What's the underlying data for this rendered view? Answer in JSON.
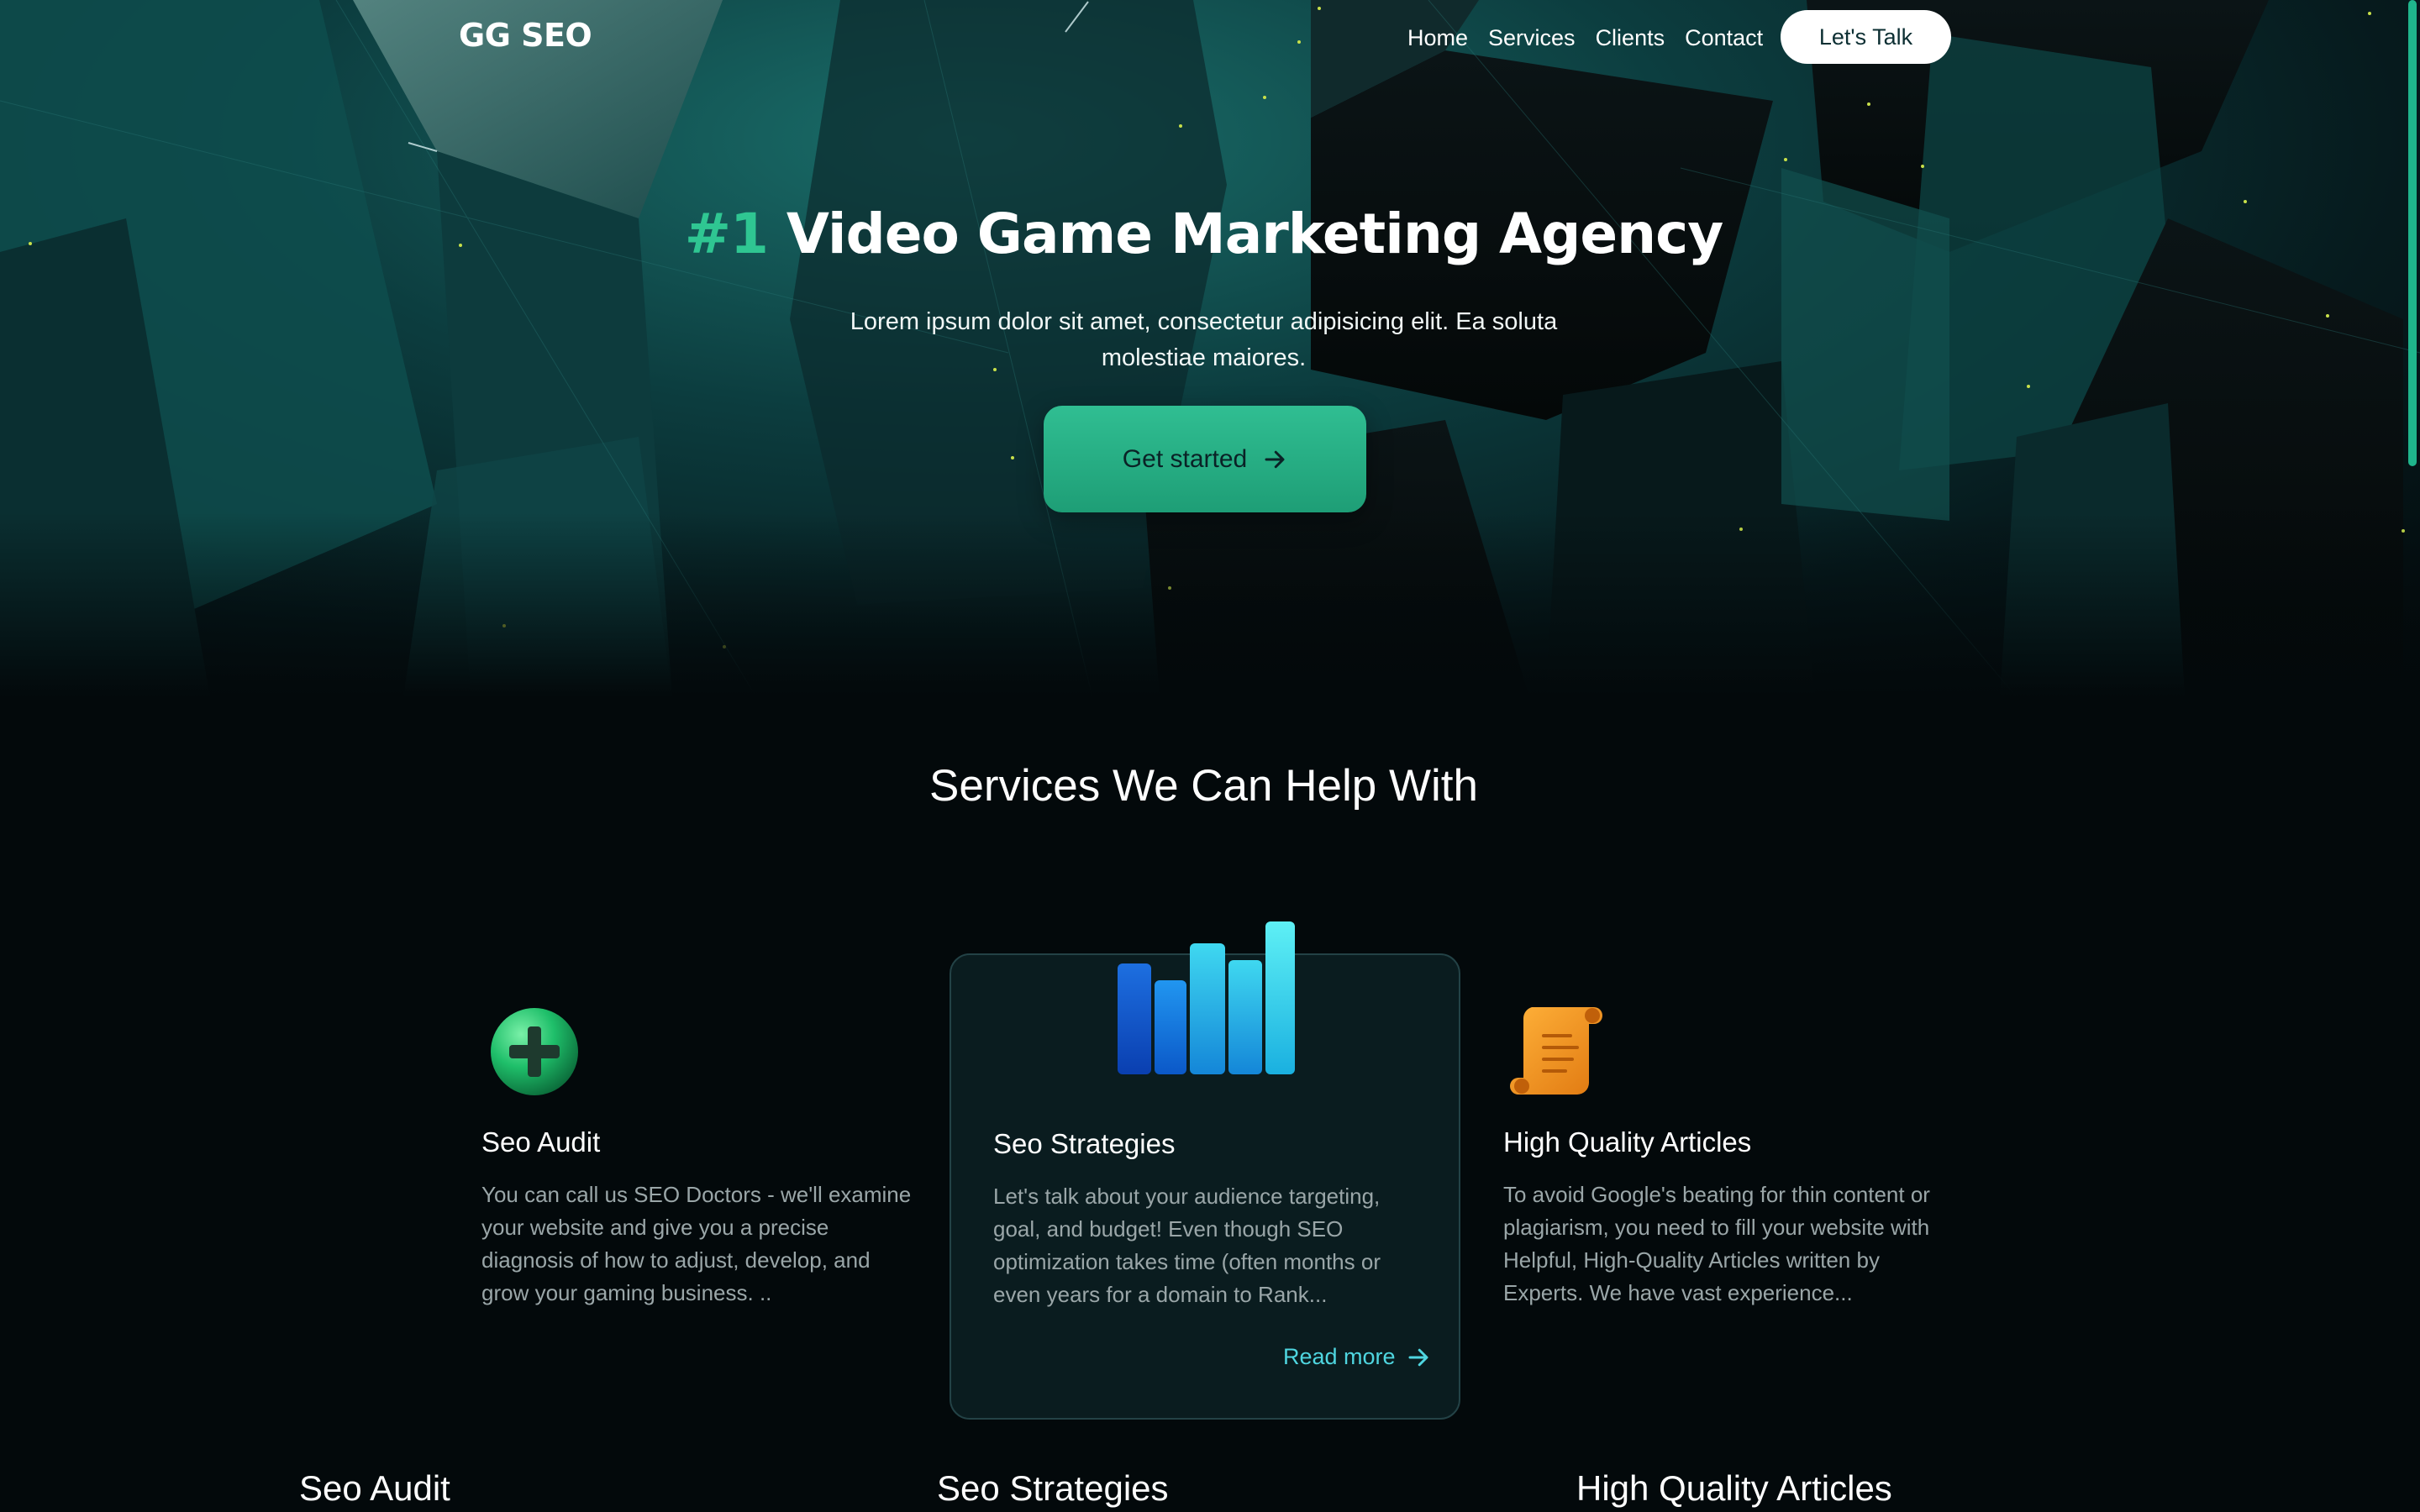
{
  "nav": {
    "logo": "GG SEO",
    "links": [
      "Home",
      "Services",
      "Clients",
      "Contact"
    ],
    "cta_label": "Let's Talk"
  },
  "hero": {
    "headline_accent": "#1",
    "headline_rest": " Video Game Marketing Agency",
    "subtitle": "Lorem ipsum dolor sit amet, consectetur adipisicing elit. Ea soluta molestiae maiores.",
    "cta_label": "Get started"
  },
  "services": {
    "title": "Services We Can Help With",
    "cards": [
      {
        "icon": "plus-circle-icon",
        "title": "Seo Audit",
        "text": "You can call us SEO Doctors - we'll examine your website and give you a precise diagnosis of how to adjust, develop, and grow your gaming business. .."
      },
      {
        "icon": "bar-chart-icon",
        "title": "Seo Strategies",
        "text": "Let's talk about your audience targeting, goal, and budget! Even though SEO optimization takes time (often months or even years for a domain to Rank...",
        "link": "Read more"
      },
      {
        "icon": "scroll-icon",
        "title": "High Quality Articles",
        "text": "To avoid Google's beating for thin content or plagiarism, you need to fill your website with Helpful, High-Quality Articles written by Experts. We have vast experience..."
      }
    ]
  },
  "below": {
    "headings": [
      "Seo Audit",
      "Seo Strategies",
      "High Quality Articles"
    ]
  },
  "colors": {
    "accent_green": "#2fc692",
    "link_cyan": "#4fd6e0",
    "background": "#03090b",
    "card_bg": "#0a1c1f"
  }
}
